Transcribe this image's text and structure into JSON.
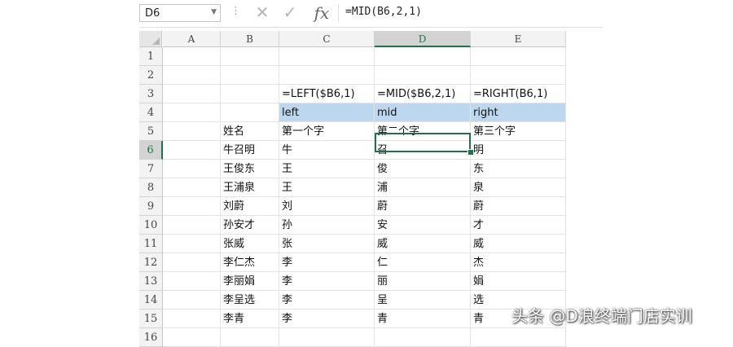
{
  "name_box": {
    "value": "D6"
  },
  "formula_bar": {
    "cancel_glyph": "✕",
    "enter_glyph": "✓",
    "fx_label": "fx",
    "formula": "=MID(B6,2,1)"
  },
  "columns": [
    "A",
    "B",
    "C",
    "D",
    "E"
  ],
  "active_column": "D",
  "rows": [
    "1",
    "2",
    "3",
    "4",
    "5",
    "6",
    "7",
    "8",
    "9",
    "10",
    "11",
    "12",
    "13",
    "14",
    "15",
    "16"
  ],
  "active_row": "6",
  "cells": {
    "formula_row": {
      "c": "=LEFT($B6,1)",
      "d": "=MID($B6,2,1)",
      "e": "=RIGHT(B6,1)"
    },
    "label_row": {
      "c": "left",
      "d": "mid",
      "e": "right"
    },
    "header_row": {
      "b": "姓名",
      "c": "第一个字",
      "d": "第二个字",
      "e": "第三个字"
    },
    "data": [
      {
        "b": "牛召明",
        "c": "牛",
        "d": "召",
        "e": "明"
      },
      {
        "b": "王俊东",
        "c": "王",
        "d": "俊",
        "e": "东"
      },
      {
        "b": "王浦泉",
        "c": "王",
        "d": "浦",
        "e": "泉"
      },
      {
        "b": "刘蔚",
        "c": "刘",
        "d": "蔚",
        "e": "蔚"
      },
      {
        "b": "孙安才",
        "c": "孙",
        "d": "安",
        "e": "才"
      },
      {
        "b": "张威",
        "c": "张",
        "d": "威",
        "e": "威"
      },
      {
        "b": "李仁杰",
        "c": "李",
        "d": "仁",
        "e": "杰"
      },
      {
        "b": "李丽娟",
        "c": "李",
        "d": "丽",
        "e": "娟"
      },
      {
        "b": "李呈选",
        "c": "李",
        "d": "呈",
        "e": "选"
      },
      {
        "b": "李青",
        "c": "李",
        "d": "青",
        "e": "青"
      }
    ]
  },
  "watermark": "头条 @D浪终端门店实训",
  "colors": {
    "accent_green": "#217346",
    "label_fill": "#bdd7ee"
  }
}
